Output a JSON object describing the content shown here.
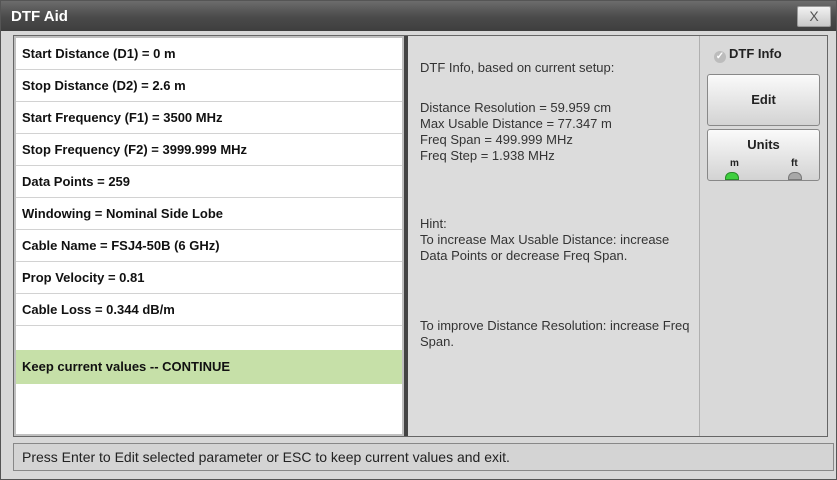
{
  "window": {
    "title": "DTF Aid",
    "close_label": "X"
  },
  "params": [
    "Start Distance (D1) = 0 m",
    "Stop Distance (D2) = 2.6 m",
    "Start Frequency (F1) = 3500 MHz",
    "Stop Frequency (F2) = 3999.999 MHz",
    "Data Points = 259",
    "Windowing = Nominal Side Lobe",
    "Cable Name = FSJ4-50B (6 GHz)",
    "Prop Velocity = 0.81",
    "Cable Loss = 0.344 dB/m",
    "Keep current values -- CONTINUE"
  ],
  "selected_index": 9,
  "info": {
    "header": "DTF Info, based on current setup:",
    "lines": [
      "Distance Resolution = 59.959 cm",
      "Max Usable Distance = 77.347 m",
      "Freq Span = 499.999 MHz",
      "Freq Step = 1.938 MHz"
    ],
    "hint_label": "Hint:",
    "hint1": "To increase Max Usable Distance: increase Data Points or decrease Freq Span.",
    "hint2": "To improve Distance Resolution: increase Freq Span."
  },
  "side": {
    "checkbox_label": "DTF Info",
    "checkbox_checked": true,
    "edit_label": "Edit",
    "units_label": "Units",
    "units_options": [
      "m",
      "ft"
    ],
    "units_selected": "m"
  },
  "status": "Press Enter to Edit selected parameter or ESC to keep current values and exit.",
  "colors": {
    "selected_row": "#c6e0a8",
    "led_on": "#3ecf3e",
    "led_off": "#a8a8a8"
  }
}
